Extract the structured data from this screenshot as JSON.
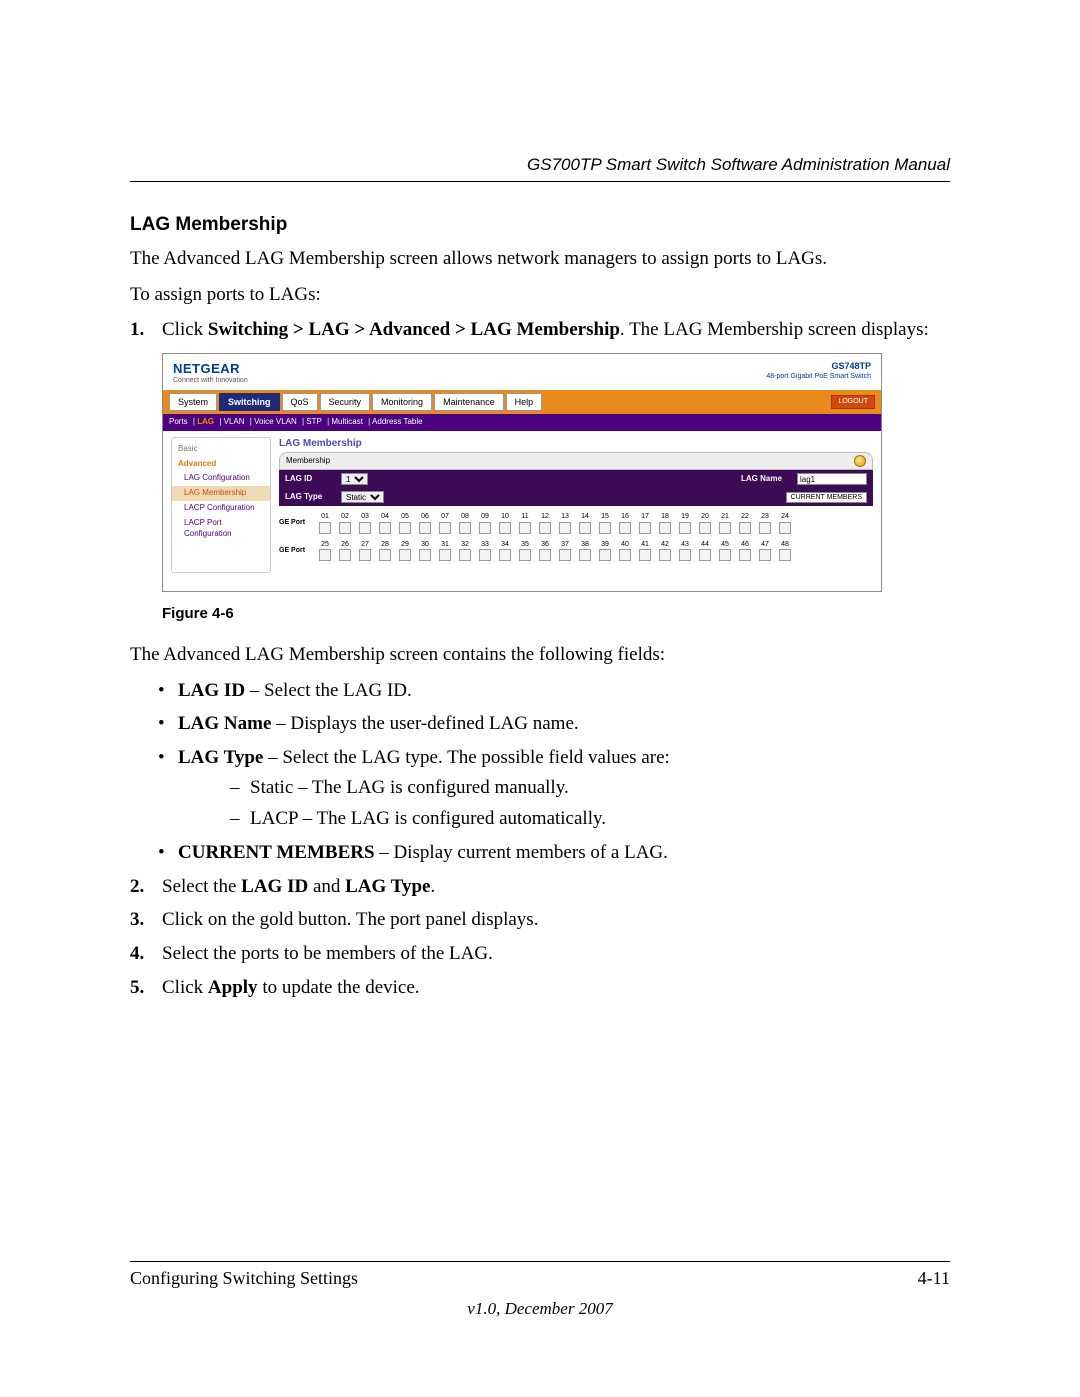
{
  "doc_header": "GS700TP Smart Switch Software Administration Manual",
  "section_heading": "LAG Membership",
  "intro": "The Advanced LAG Membership screen allows network managers to assign ports to LAGs.",
  "intro2": "To assign ports to LAGs:",
  "step1_prefix": "Click ",
  "step1_bold": "Switching > LAG > Advanced > LAG Membership",
  "step1_suffix": ". The LAG Membership screen displays:",
  "figure_caption": "Figure 4-6",
  "after_fig": "The Advanced LAG Membership screen contains the following fields:",
  "field_lagid_b": "LAG ID",
  "field_lagid_t": " – Select the LAG ID.",
  "field_lagname_b": "LAG Name",
  "field_lagname_t": " – Displays the user-defined LAG name.",
  "field_lagtype_b": "LAG Type",
  "field_lagtype_t": " – Select the LAG type. The possible field values are:",
  "sub_static": "Static – The LAG is configured manually.",
  "sub_lacp": "LACP – The LAG is configured automatically.",
  "field_cm_b": "CURRENT MEMBERS",
  "field_cm_t": " – Display current members of a LAG.",
  "step2_pre": "Select the ",
  "step2_b1": "LAG ID",
  "step2_mid": " and ",
  "step2_b2": "LAG Type",
  "step2_post": ".",
  "step3": "Click on the gold button. The port panel displays.",
  "step4": "Select the ports to be members of the LAG.",
  "step5_pre": "Click ",
  "step5_b": "Apply",
  "step5_post": " to update the device.",
  "footer_left": "Configuring Switching Settings",
  "footer_right": "4-11",
  "footer_version": "v1.0, December 2007",
  "shot": {
    "logo": "NETGEAR",
    "logo_sub": "Connect with Innovation",
    "product": "GS748TP",
    "product_desc": "48-port Gigabit PoE Smart Switch",
    "logout": "LOGOUT",
    "main_tabs": [
      "System",
      "Switching",
      "QoS",
      "Security",
      "Monitoring",
      "Maintenance",
      "Help"
    ],
    "active_main": "Switching",
    "sub_tabs": [
      "Ports",
      "LAG",
      "VLAN",
      "Voice VLAN",
      "STP",
      "Multicast",
      "Address Table"
    ],
    "active_sub": "LAG",
    "side": {
      "basic": "Basic",
      "adv": "Advanced",
      "items": [
        "LAG Configuration",
        "LAG Membership",
        "LACP Configuration",
        "LACP Port Configuration"
      ],
      "selected": "LAG Membership"
    },
    "panel_title": "LAG Membership",
    "membership_label": "Membership",
    "form": {
      "lagid": "LAG ID",
      "lagid_val": "1",
      "lagname": "LAG Name",
      "lagname_val": "lag1",
      "lagtype": "LAG Type",
      "lagtype_val": "Static",
      "cur_members": "CURRENT MEMBERS"
    },
    "port_label": "GE Port",
    "ports_row1": [
      "01",
      "02",
      "03",
      "04",
      "05",
      "06",
      "07",
      "08",
      "09",
      "10",
      "11",
      "12",
      "13",
      "14",
      "15",
      "16",
      "17",
      "18",
      "19",
      "20",
      "21",
      "22",
      "23",
      "24"
    ],
    "ports_row2": [
      "25",
      "26",
      "27",
      "28",
      "29",
      "30",
      "31",
      "32",
      "33",
      "34",
      "35",
      "36",
      "37",
      "38",
      "39",
      "40",
      "41",
      "42",
      "43",
      "44",
      "45",
      "46",
      "47",
      "48"
    ]
  }
}
